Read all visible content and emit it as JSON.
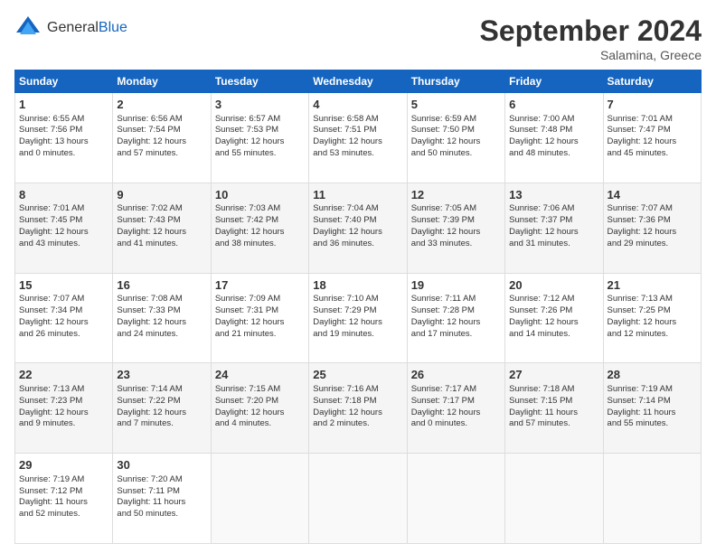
{
  "header": {
    "logo_general": "General",
    "logo_blue": "Blue",
    "title": "September 2024",
    "location": "Salamina, Greece"
  },
  "weekdays": [
    "Sunday",
    "Monday",
    "Tuesday",
    "Wednesday",
    "Thursday",
    "Friday",
    "Saturday"
  ],
  "weeks": [
    [
      {
        "day": "1",
        "info": "Sunrise: 6:55 AM\nSunset: 7:56 PM\nDaylight: 13 hours\nand 0 minutes."
      },
      {
        "day": "2",
        "info": "Sunrise: 6:56 AM\nSunset: 7:54 PM\nDaylight: 12 hours\nand 57 minutes."
      },
      {
        "day": "3",
        "info": "Sunrise: 6:57 AM\nSunset: 7:53 PM\nDaylight: 12 hours\nand 55 minutes."
      },
      {
        "day": "4",
        "info": "Sunrise: 6:58 AM\nSunset: 7:51 PM\nDaylight: 12 hours\nand 53 minutes."
      },
      {
        "day": "5",
        "info": "Sunrise: 6:59 AM\nSunset: 7:50 PM\nDaylight: 12 hours\nand 50 minutes."
      },
      {
        "day": "6",
        "info": "Sunrise: 7:00 AM\nSunset: 7:48 PM\nDaylight: 12 hours\nand 48 minutes."
      },
      {
        "day": "7",
        "info": "Sunrise: 7:01 AM\nSunset: 7:47 PM\nDaylight: 12 hours\nand 45 minutes."
      }
    ],
    [
      {
        "day": "8",
        "info": "Sunrise: 7:01 AM\nSunset: 7:45 PM\nDaylight: 12 hours\nand 43 minutes."
      },
      {
        "day": "9",
        "info": "Sunrise: 7:02 AM\nSunset: 7:43 PM\nDaylight: 12 hours\nand 41 minutes."
      },
      {
        "day": "10",
        "info": "Sunrise: 7:03 AM\nSunset: 7:42 PM\nDaylight: 12 hours\nand 38 minutes."
      },
      {
        "day": "11",
        "info": "Sunrise: 7:04 AM\nSunset: 7:40 PM\nDaylight: 12 hours\nand 36 minutes."
      },
      {
        "day": "12",
        "info": "Sunrise: 7:05 AM\nSunset: 7:39 PM\nDaylight: 12 hours\nand 33 minutes."
      },
      {
        "day": "13",
        "info": "Sunrise: 7:06 AM\nSunset: 7:37 PM\nDaylight: 12 hours\nand 31 minutes."
      },
      {
        "day": "14",
        "info": "Sunrise: 7:07 AM\nSunset: 7:36 PM\nDaylight: 12 hours\nand 29 minutes."
      }
    ],
    [
      {
        "day": "15",
        "info": "Sunrise: 7:07 AM\nSunset: 7:34 PM\nDaylight: 12 hours\nand 26 minutes."
      },
      {
        "day": "16",
        "info": "Sunrise: 7:08 AM\nSunset: 7:33 PM\nDaylight: 12 hours\nand 24 minutes."
      },
      {
        "day": "17",
        "info": "Sunrise: 7:09 AM\nSunset: 7:31 PM\nDaylight: 12 hours\nand 21 minutes."
      },
      {
        "day": "18",
        "info": "Sunrise: 7:10 AM\nSunset: 7:29 PM\nDaylight: 12 hours\nand 19 minutes."
      },
      {
        "day": "19",
        "info": "Sunrise: 7:11 AM\nSunset: 7:28 PM\nDaylight: 12 hours\nand 17 minutes."
      },
      {
        "day": "20",
        "info": "Sunrise: 7:12 AM\nSunset: 7:26 PM\nDaylight: 12 hours\nand 14 minutes."
      },
      {
        "day": "21",
        "info": "Sunrise: 7:13 AM\nSunset: 7:25 PM\nDaylight: 12 hours\nand 12 minutes."
      }
    ],
    [
      {
        "day": "22",
        "info": "Sunrise: 7:13 AM\nSunset: 7:23 PM\nDaylight: 12 hours\nand 9 minutes."
      },
      {
        "day": "23",
        "info": "Sunrise: 7:14 AM\nSunset: 7:22 PM\nDaylight: 12 hours\nand 7 minutes."
      },
      {
        "day": "24",
        "info": "Sunrise: 7:15 AM\nSunset: 7:20 PM\nDaylight: 12 hours\nand 4 minutes."
      },
      {
        "day": "25",
        "info": "Sunrise: 7:16 AM\nSunset: 7:18 PM\nDaylight: 12 hours\nand 2 minutes."
      },
      {
        "day": "26",
        "info": "Sunrise: 7:17 AM\nSunset: 7:17 PM\nDaylight: 12 hours\nand 0 minutes."
      },
      {
        "day": "27",
        "info": "Sunrise: 7:18 AM\nSunset: 7:15 PM\nDaylight: 11 hours\nand 57 minutes."
      },
      {
        "day": "28",
        "info": "Sunrise: 7:19 AM\nSunset: 7:14 PM\nDaylight: 11 hours\nand 55 minutes."
      }
    ],
    [
      {
        "day": "29",
        "info": "Sunrise: 7:19 AM\nSunset: 7:12 PM\nDaylight: 11 hours\nand 52 minutes."
      },
      {
        "day": "30",
        "info": "Sunrise: 7:20 AM\nSunset: 7:11 PM\nDaylight: 11 hours\nand 50 minutes."
      },
      {
        "day": "",
        "info": ""
      },
      {
        "day": "",
        "info": ""
      },
      {
        "day": "",
        "info": ""
      },
      {
        "day": "",
        "info": ""
      },
      {
        "day": "",
        "info": ""
      }
    ]
  ]
}
